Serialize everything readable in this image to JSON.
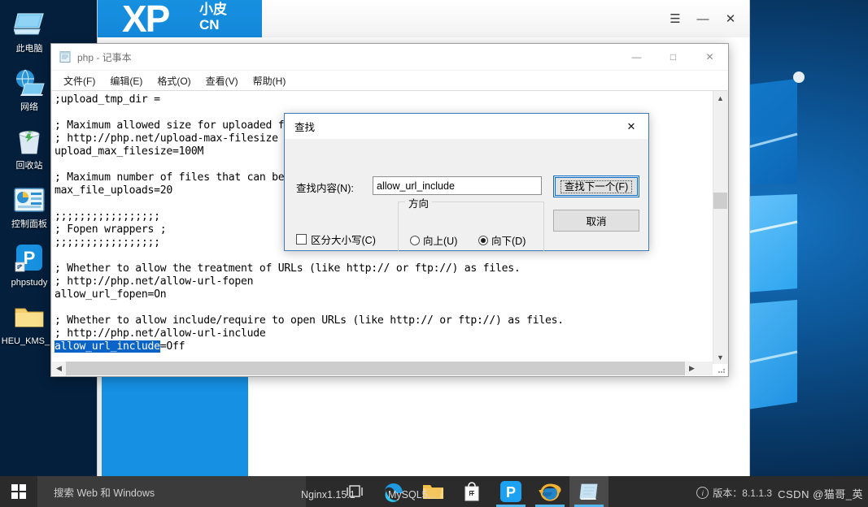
{
  "desktop": {
    "icons": [
      {
        "label": "此电脑",
        "icon": "this-pc-icon"
      },
      {
        "label": "网络",
        "icon": "network-icon"
      },
      {
        "label": "回收站",
        "icon": "recycle-bin-icon"
      },
      {
        "label": "控制面板",
        "icon": "control-panel-icon"
      },
      {
        "label": "phpstudy",
        "icon": "phpstudy-shortcut-icon"
      },
      {
        "label": "HEU_KMS_...",
        "icon": "folder-icon"
      }
    ]
  },
  "phpstudy_window": {
    "logo_main": "XP",
    "logo_sub_line1": "小皮",
    "logo_sub_line2": "CN",
    "controls": {
      "menu": "☰",
      "minimize": "—",
      "close": "✕"
    },
    "accent_color": "#1590e3"
  },
  "notepad": {
    "title": "php - 记事本",
    "icon": "notepad-icon",
    "controls": {
      "minimize": "—",
      "maximize": "□",
      "close": "✕"
    },
    "menu": [
      {
        "label": "文件(F)",
        "name": "menu-file"
      },
      {
        "label": "编辑(E)",
        "name": "menu-edit"
      },
      {
        "label": "格式(O)",
        "name": "menu-format"
      },
      {
        "label": "查看(V)",
        "name": "menu-view"
      },
      {
        "label": "帮助(H)",
        "name": "menu-help"
      }
    ],
    "lines": [
      ";upload_tmp_dir =",
      "",
      "; Maximum allowed size for uploaded files.",
      "; http://php.net/upload-max-filesize",
      "upload_max_filesize=100M",
      "",
      "; Maximum number of files that can be uploaded via a single request",
      "max_file_uploads=20",
      "",
      ";;;;;;;;;;;;;;;;;",
      "; Fopen wrappers ;",
      ";;;;;;;;;;;;;;;;;",
      "",
      "; Whether to allow the treatment of URLs (like http:// or ftp://) as files.",
      "; http://php.net/allow-url-fopen",
      "allow_url_fopen=On",
      "",
      "; Whether to allow include/require to open URLs (like http:// or ftp://) as files.",
      "; http://php.net/allow-url-include",
      "allow_url_include=Off"
    ],
    "selected_text": "allow_url_include",
    "selected_line_suffix": "=Off",
    "selection_color": "#0a64c8"
  },
  "find_dialog": {
    "title": "查找",
    "close": "✕",
    "search_label": "查找内容(N):",
    "search_value": "allow_url_include",
    "search_placeholder": "",
    "find_next_button": "查找下一个(F)",
    "cancel_button": "取消",
    "direction_legend": "方向",
    "direction_up": "向上(U)",
    "direction_down": "向下(D)",
    "direction_selected": "向下(D)",
    "match_case_label": "区分大小写(C)",
    "match_case_checked": false
  },
  "taskbar": {
    "start_icon": "windows-start-icon",
    "search_placeholder": "搜索 Web 和 Windows",
    "task_view_icon": "task-view-icon",
    "items": [
      {
        "name": "taskbar-edge",
        "icon": "edge-icon",
        "active": false
      },
      {
        "name": "taskbar-file-explorer",
        "icon": "folder-icon",
        "active": false
      },
      {
        "name": "taskbar-store",
        "icon": "store-icon",
        "active": false
      },
      {
        "name": "taskbar-phpstudy",
        "icon": "phpstudy-icon",
        "active": false,
        "running": true
      },
      {
        "name": "taskbar-internet-explorer",
        "icon": "ie-icon",
        "active": false,
        "running": true
      },
      {
        "name": "taskbar-notepad",
        "icon": "notepad-icon",
        "active": true
      }
    ],
    "overlay_labels": [
      "Nginx1.15.1",
      "MySQL5..."
    ],
    "version_text": "版本：8.1.1.3",
    "version_icon": "info-icon",
    "tray_watermark": "CSDN @猫哥_英"
  }
}
